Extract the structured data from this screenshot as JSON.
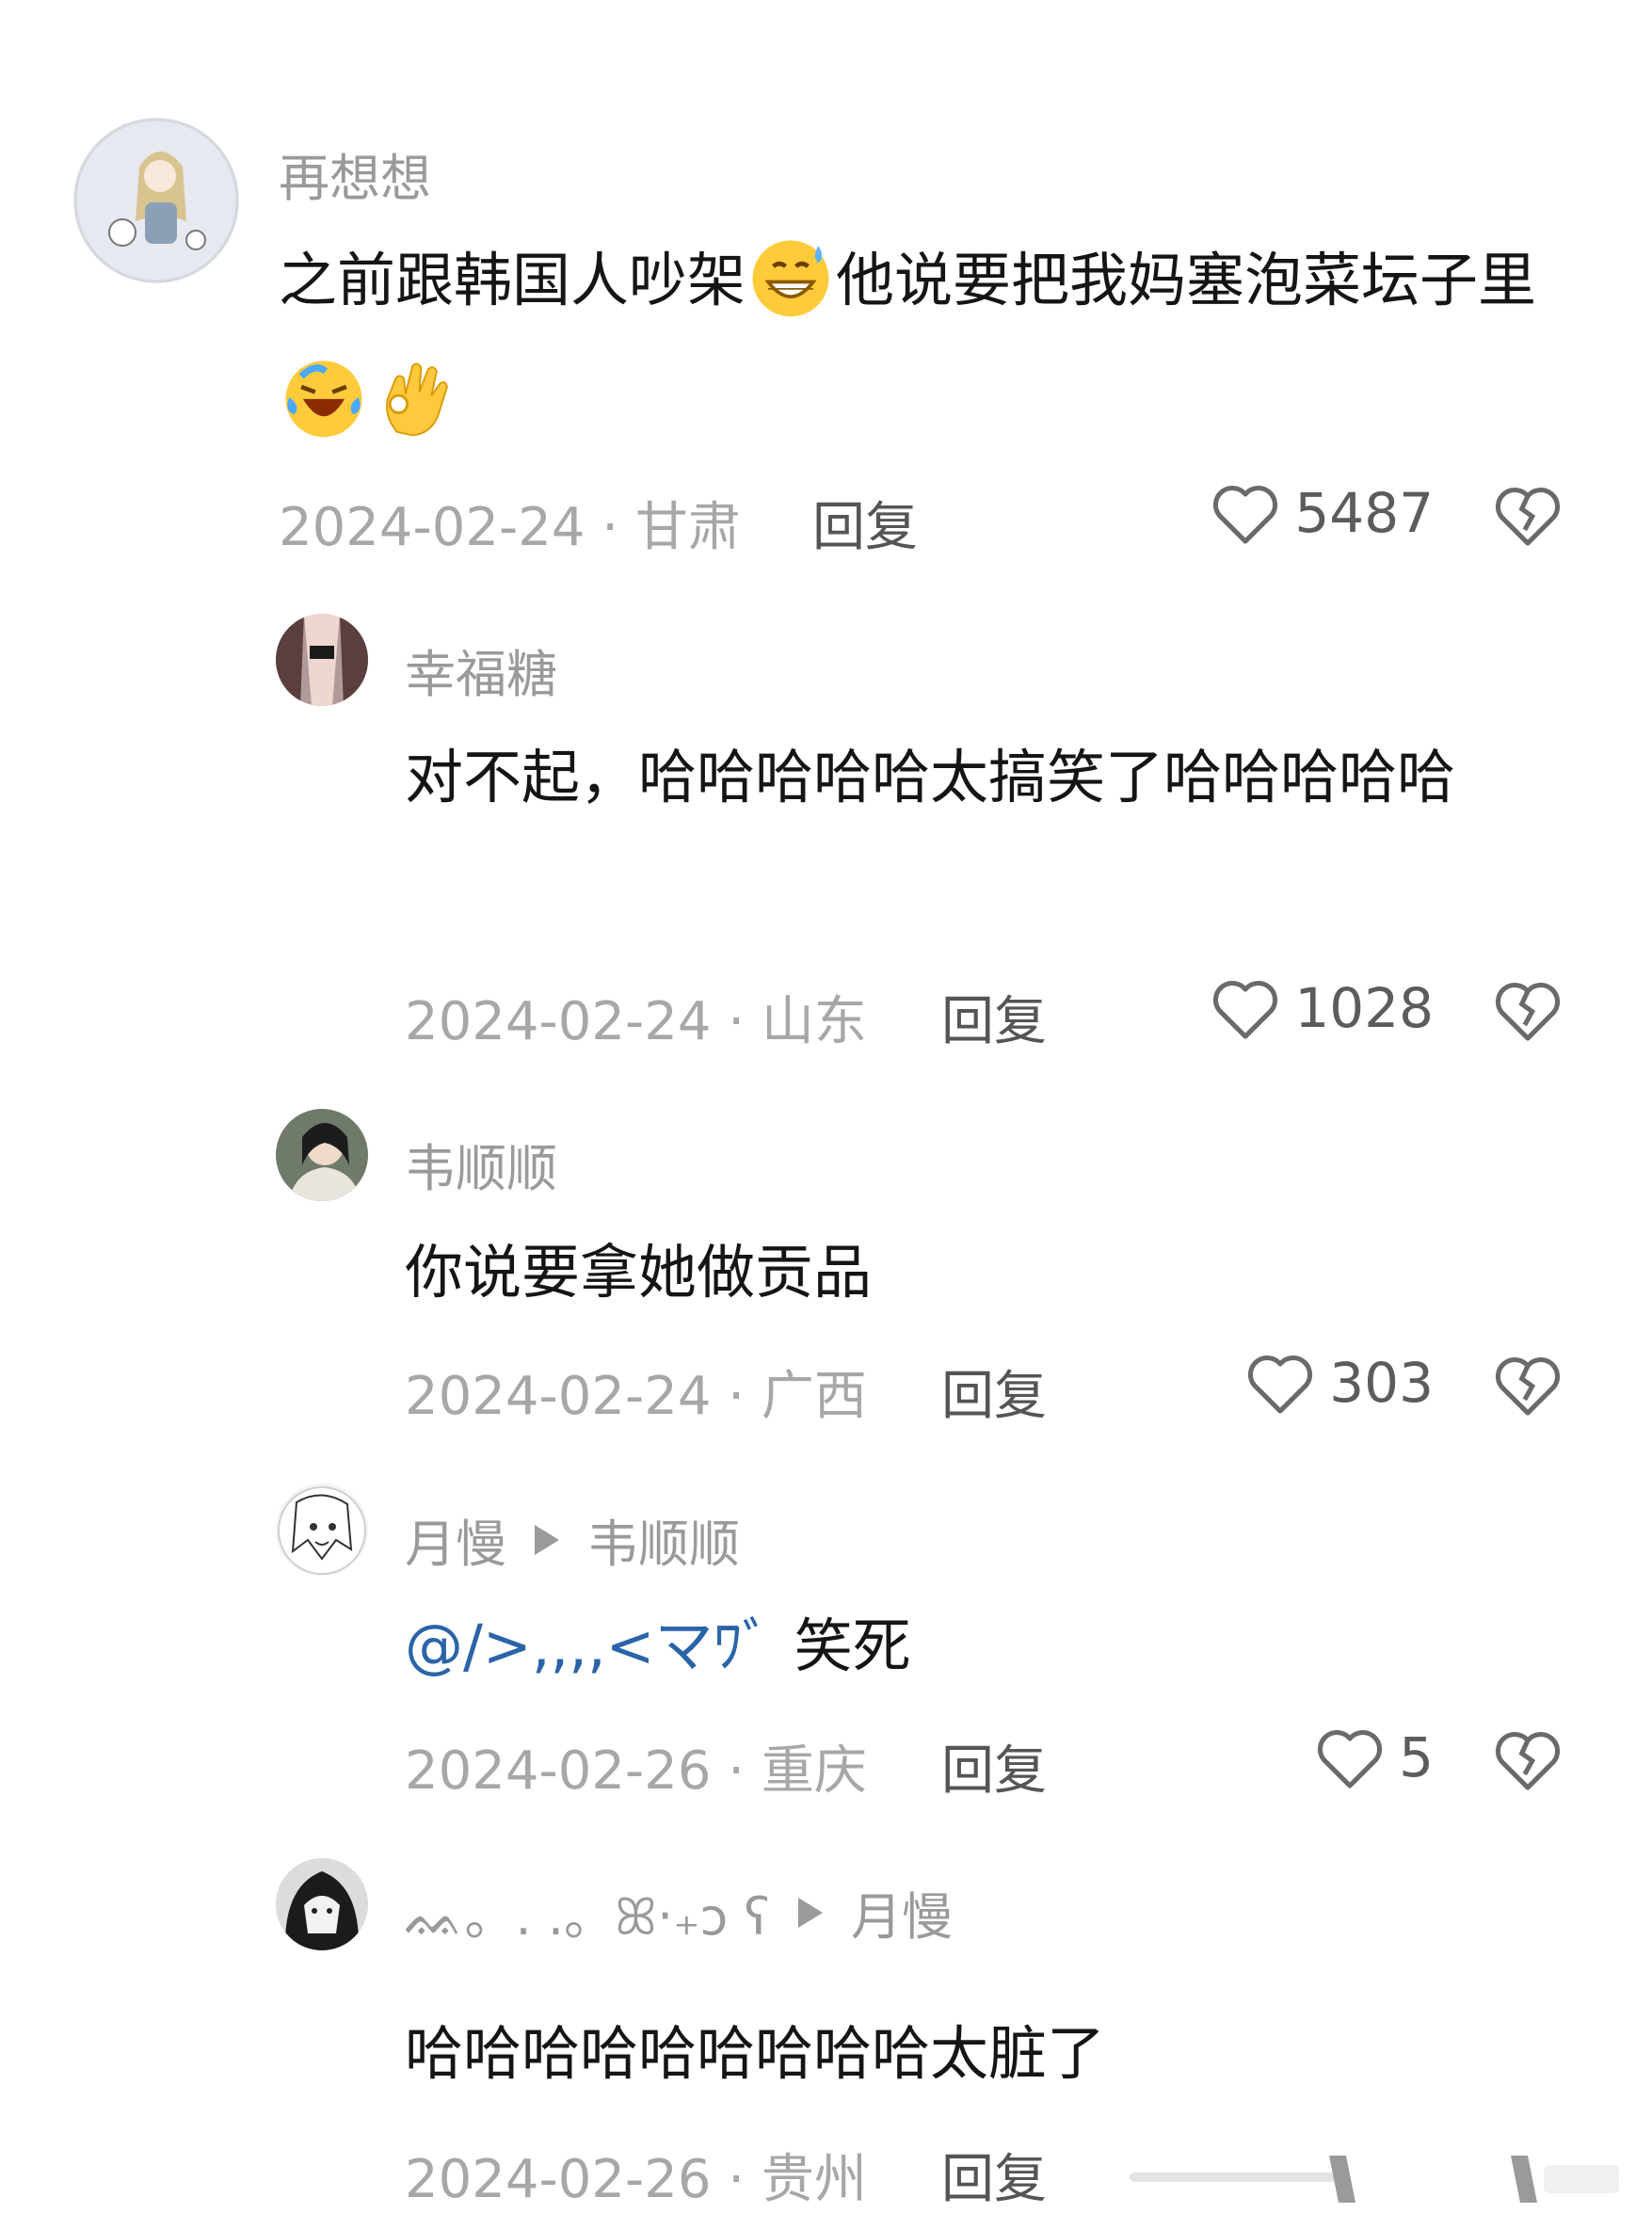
{
  "comments": [
    {
      "username": "再想想",
      "text_a": "之前跟韩国人吵架",
      "text_b": "他说要把我妈塞泡菜坛子里",
      "date": "2024-02-24",
      "region": "甘肃",
      "reply_label": "回复",
      "likes": "5487"
    },
    {
      "username": "幸福糖",
      "text": "对不起，哈哈哈哈哈太搞笑了哈哈哈哈哈",
      "date": "2024-02-24",
      "region": "山东",
      "reply_label": "回复",
      "likes": "1028"
    },
    {
      "username": "韦顺顺",
      "text": "你说要拿她做贡品",
      "date": "2024-02-24",
      "region": "广西",
      "reply_label": "回复",
      "likes": "303"
    },
    {
      "username": "月慢",
      "reply_to": "韦顺顺",
      "mention": "@/>,,,,<マﾜﾞ",
      "text": "笑死",
      "date": "2024-02-26",
      "region": "重庆",
      "reply_label": "回复",
      "likes": "5"
    },
    {
      "username": "ᨐ。. .。ꕤ‧₊ɔ ʕ",
      "reply_to": "月慢",
      "text": "哈哈哈哈哈哈哈哈哈太脏了",
      "date": "2024-02-26",
      "region": "贵州",
      "reply_label": "回复"
    }
  ],
  "separator": "·",
  "icons": {
    "like": "heart-outline-icon",
    "dislike": "broken-heart-icon",
    "reply_arrow": "triangle-right-icon",
    "emojis": [
      "grinning-sweat-emoji",
      "laughing-crying-emoji",
      "ok-hand-emoji"
    ]
  },
  "colors": {
    "username": "#9a9a9a",
    "body": "#151515",
    "meta": "#a7a7a7",
    "mention": "#2a64a8"
  }
}
